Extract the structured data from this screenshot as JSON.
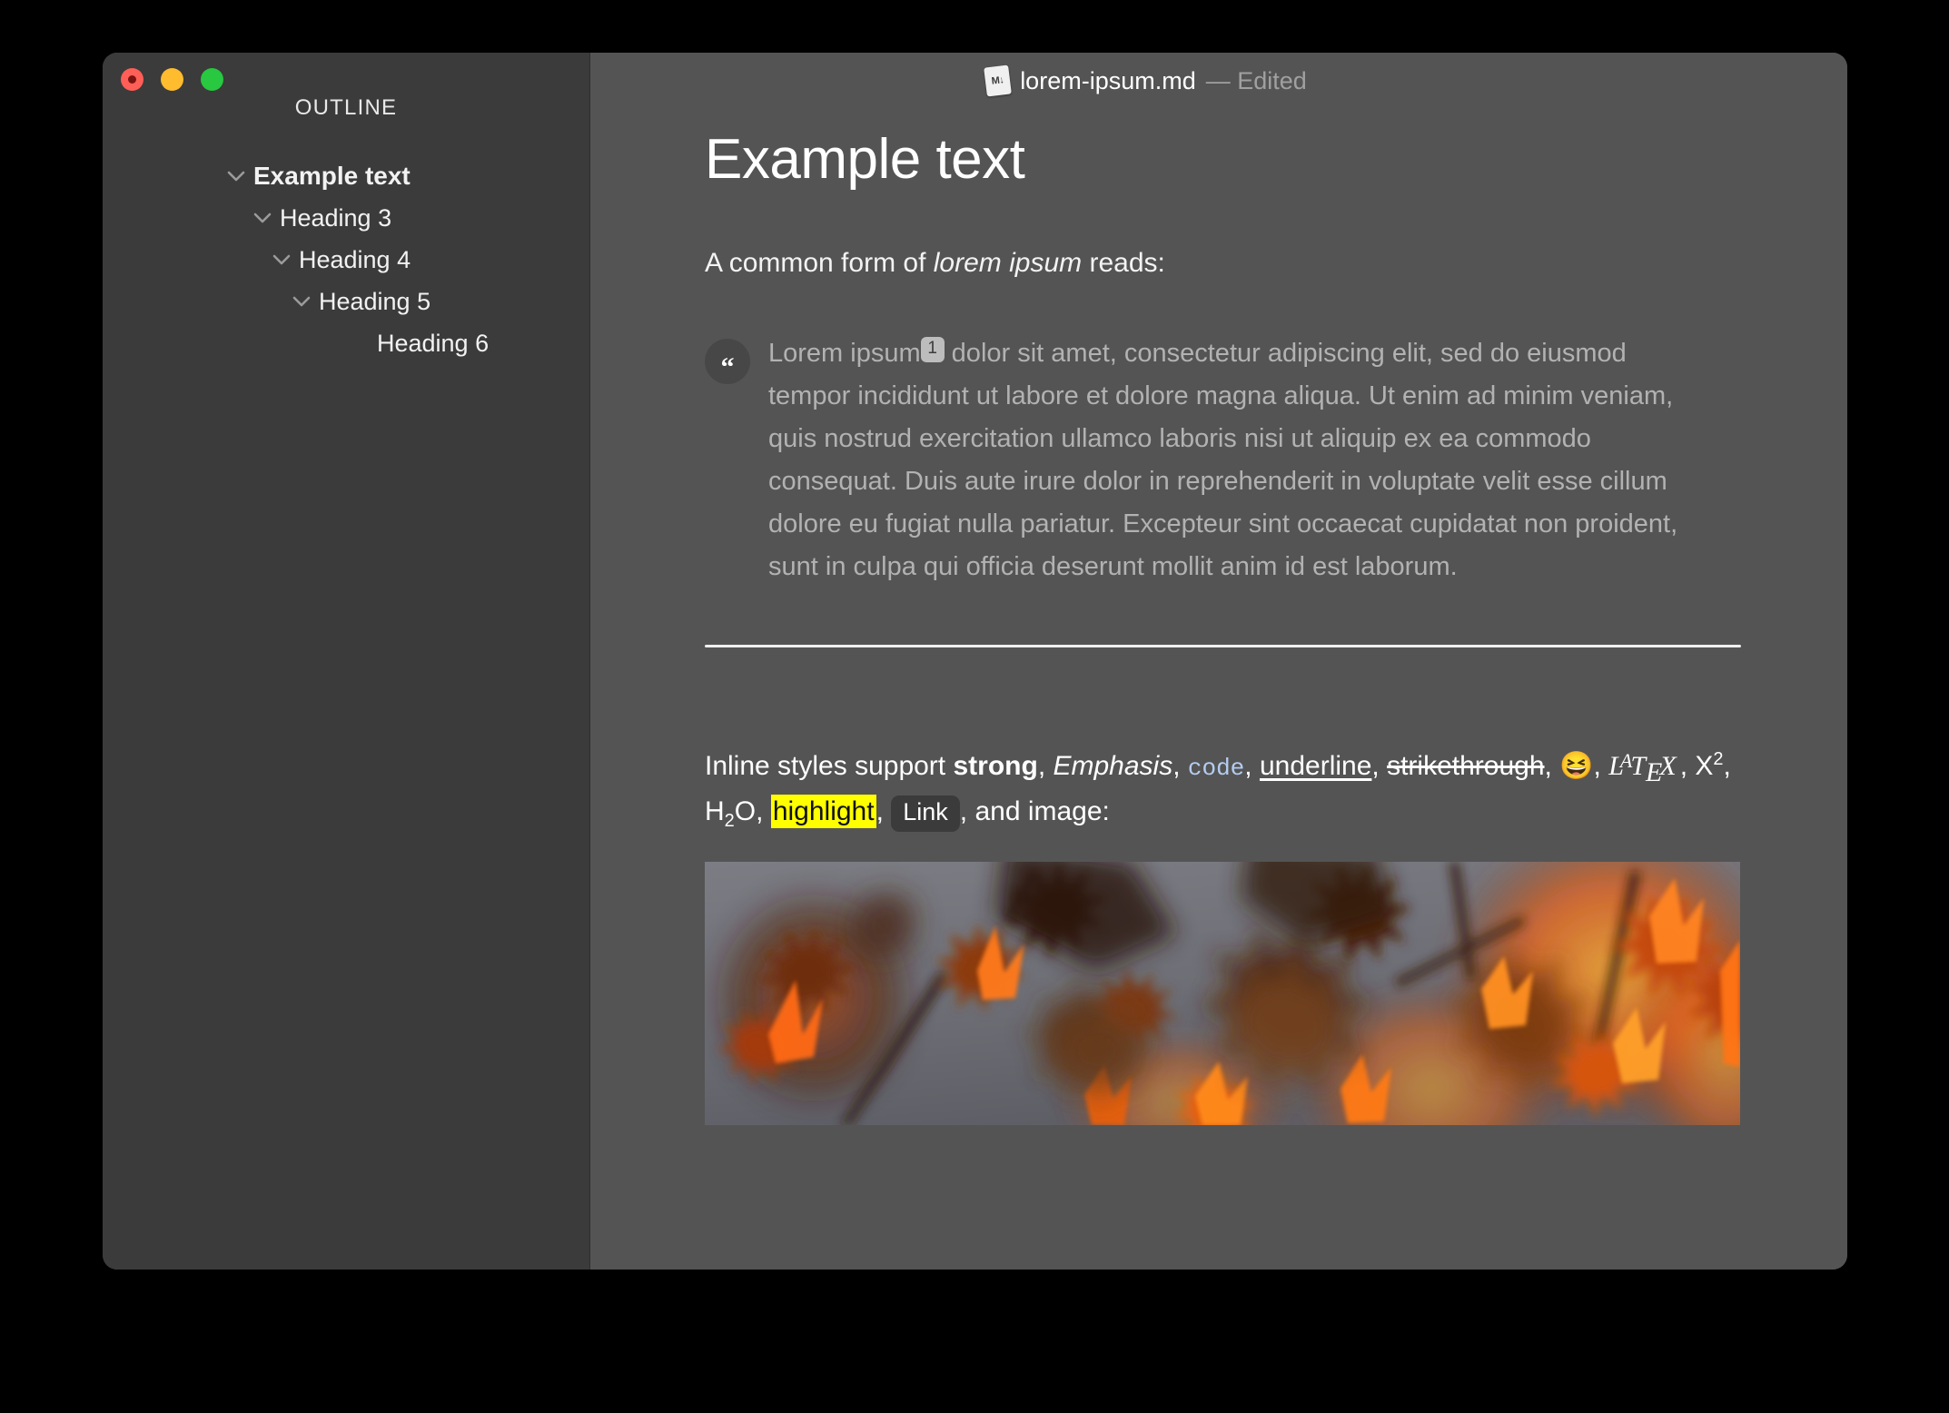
{
  "window": {
    "traffic_lights": [
      {
        "name": "close",
        "color": "#ff5f57"
      },
      {
        "name": "minimize",
        "color": "#febc2e"
      },
      {
        "name": "maximize",
        "color": "#28c840"
      }
    ]
  },
  "titlebar": {
    "file_icon_label": "M↓",
    "file_name": "lorem-ipsum.md",
    "edited_state": "— Edited"
  },
  "sidebar": {
    "heading": "OUTLINE",
    "items": [
      {
        "label": "Example text",
        "level": 0,
        "expandable": true
      },
      {
        "label": "Heading 3",
        "level": 1,
        "expandable": true
      },
      {
        "label": "Heading 4",
        "level": 2,
        "expandable": true
      },
      {
        "label": "Heading 5",
        "level": 3,
        "expandable": true
      },
      {
        "label": "Heading 6",
        "level": 4,
        "expandable": false
      }
    ]
  },
  "document": {
    "h1": "Example text",
    "intro": {
      "before": "A common form of ",
      "emphasis": "lorem ipsum",
      "after": " reads:"
    },
    "blockquote": {
      "quote_glyph": "“",
      "part1": "Lorem ipsum",
      "footnote": "1",
      "part2": " dolor sit amet, consectetur adipiscing elit, sed do eiusmod tempor incididunt ut labore et dolore magna aliqua. Ut enim ad minim veniam, quis nostrud exercitation ullamco laboris nisi ut aliquip ex ea commodo consequat. Duis aute irure dolor in reprehenderit in voluptate velit esse cillum dolore eu fugiat nulla pariatur. Excepteur sint occaecat cupidatat non proident, sunt in culpa qui officia deserunt mollit anim id est laborum."
    },
    "inline": {
      "lead": "Inline styles support ",
      "strong": "strong",
      "sep1": ", ",
      "emphasis": "Emphasis",
      "sep2": ", ",
      "code": "code",
      "sep3": ", ",
      "underline": "underline",
      "sep4": ", ",
      "strikethrough": "strikethrough",
      "sep5": ", ",
      "emoji": "😆",
      "sep6": ", ",
      "latex_l": "L",
      "latex_a": "A",
      "latex_t": "T",
      "latex_e": "E",
      "latex_x": "X",
      "sep7": ", ",
      "sup_base": "X",
      "sup_exp": "2",
      "sep8": ", ",
      "sub_h": "H",
      "sub_2": "2",
      "sub_o": "O",
      "sep9": ", ",
      "highlight": "highlight",
      "sep10": ", ",
      "link": "Link",
      "tail": ", and image:"
    },
    "image": {
      "alt": "blurred orange autumn maple leaves",
      "colors": {
        "background": "#73747a",
        "leaf_dark": "#3a1a0e",
        "leaf_mid": "#8a3410",
        "leaf_bright": "#ff6a10",
        "leaf_glow": "#ffae2e"
      }
    }
  },
  "theme": {
    "sidebar_bg": "#3b3b3b",
    "content_bg": "#545454",
    "text": "#ffffff",
    "muted_text": "#b2b2b2",
    "code_color": "#b4cdf0",
    "highlight_bg": "#ffff00"
  }
}
